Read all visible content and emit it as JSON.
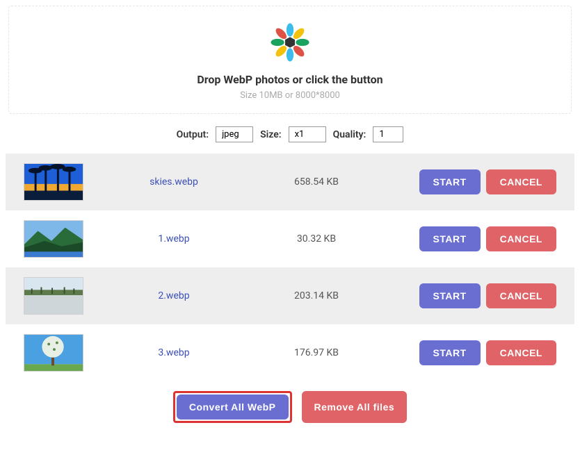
{
  "drop": {
    "title": "Drop WebP photos or click the button",
    "sub": "Size 10MB or 8000*8000"
  },
  "settings": {
    "output_label": "Output",
    "output_value": "jpeg",
    "size_label": "Size",
    "size_value": "x1",
    "quality_label": "Quality",
    "quality_value": "1"
  },
  "buttons": {
    "start": "START",
    "cancel": "CANCEL",
    "convert_all": "Convert All WebP",
    "remove_all": "Remove All files"
  },
  "files": [
    {
      "name": "skies.webp",
      "size": "658.54 KB"
    },
    {
      "name": "1.webp",
      "size": "30.32 KB"
    },
    {
      "name": "2.webp",
      "size": "203.14 KB"
    },
    {
      "name": "3.webp",
      "size": "176.97 KB"
    }
  ]
}
